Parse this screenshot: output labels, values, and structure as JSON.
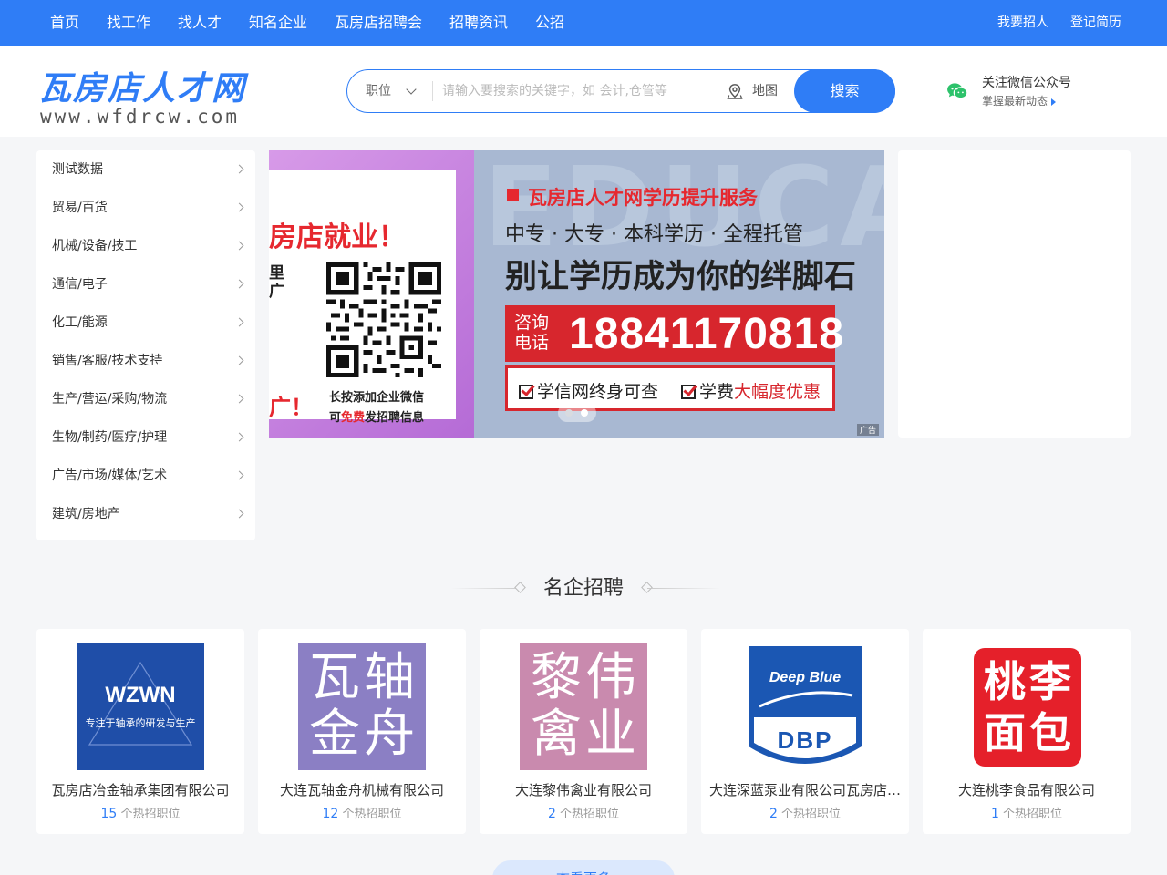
{
  "topnav": {
    "items": [
      "首页",
      "找工作",
      "找人才",
      "知名企业",
      "瓦房店招聘会",
      "招聘资讯",
      "公招"
    ],
    "right": [
      "我要招人",
      "登记简历"
    ]
  },
  "header": {
    "logo_main": "瓦房店人才网",
    "logo_sub": "www.wfdrcw.com",
    "search": {
      "type_label": "职位",
      "placeholder": "请输入要搜索的关键字，如 会计,仓管等",
      "value": "",
      "map_label": "地图",
      "button_label": "搜索"
    },
    "wechat": {
      "title": "关注微信公众号",
      "subtitle": "掌握最新动态"
    }
  },
  "categories": [
    "测试数据",
    "贸易/百货",
    "机械/设备/技工",
    "通信/电子",
    "化工/能源",
    "销售/客服/技术支持",
    "生产/营运/采购/物流",
    "生物/制药/医疗/护理",
    "广告/市场/媒体/艺术",
    "建筑/房地产"
  ],
  "banner": {
    "slide_a": {
      "title": "房店就业！",
      "left_line1": "里",
      "left_line2": "广",
      "left_line3": "广！",
      "caption1": "长按添加企业微信",
      "caption2_pre": "可",
      "caption2_red": "免费",
      "caption2_post": "发招聘信息"
    },
    "slide_b": {
      "bg_text": "EDUCA",
      "title": "瓦房店人才网学历提升服务",
      "subtitle": "中专 · 大专 · 本科学历 · 全程托管",
      "headline": "别让学历成为你的绊脚石",
      "phone_label": "咨询电话",
      "phone": "18841170818",
      "feature1": "学信网终身可查",
      "feature2_pre": "学费",
      "feature2_red": "大幅度优惠"
    },
    "ad_tag": "广告",
    "slide_count": 2,
    "active_slide": 2
  },
  "section": {
    "title": "名企招聘"
  },
  "companies": [
    {
      "name": "瓦房店冶金轴承集团有限公司",
      "count": "15",
      "count_suffix": "个热招职位",
      "logo_text": "WZWN",
      "logo_tagline": "专注于轴承的研发与生产"
    },
    {
      "name": "大连瓦轴金舟机械有限公司",
      "count": "12",
      "count_suffix": "个热招职位",
      "logo_chars": [
        "瓦",
        "轴",
        "金",
        "舟"
      ]
    },
    {
      "name": "大连黎伟禽业有限公司",
      "count": "2",
      "count_suffix": "个热招职位",
      "logo_chars": [
        "黎",
        "伟",
        "禽",
        "业"
      ]
    },
    {
      "name": "大连深蓝泵业有限公司瓦房店…",
      "count": "2",
      "count_suffix": "个热招职位",
      "logo_top": "Deep Blue",
      "logo_bottom": "DBP"
    },
    {
      "name": "大连桃李食品有限公司",
      "count": "1",
      "count_suffix": "个热招职位",
      "logo_chars": [
        "桃",
        "李",
        "面",
        "包"
      ]
    }
  ],
  "more_button": "查看更多",
  "colors": {
    "primary": "#2f7df6",
    "accent_red": "#e6282f",
    "background": "#f5f6f8"
  }
}
